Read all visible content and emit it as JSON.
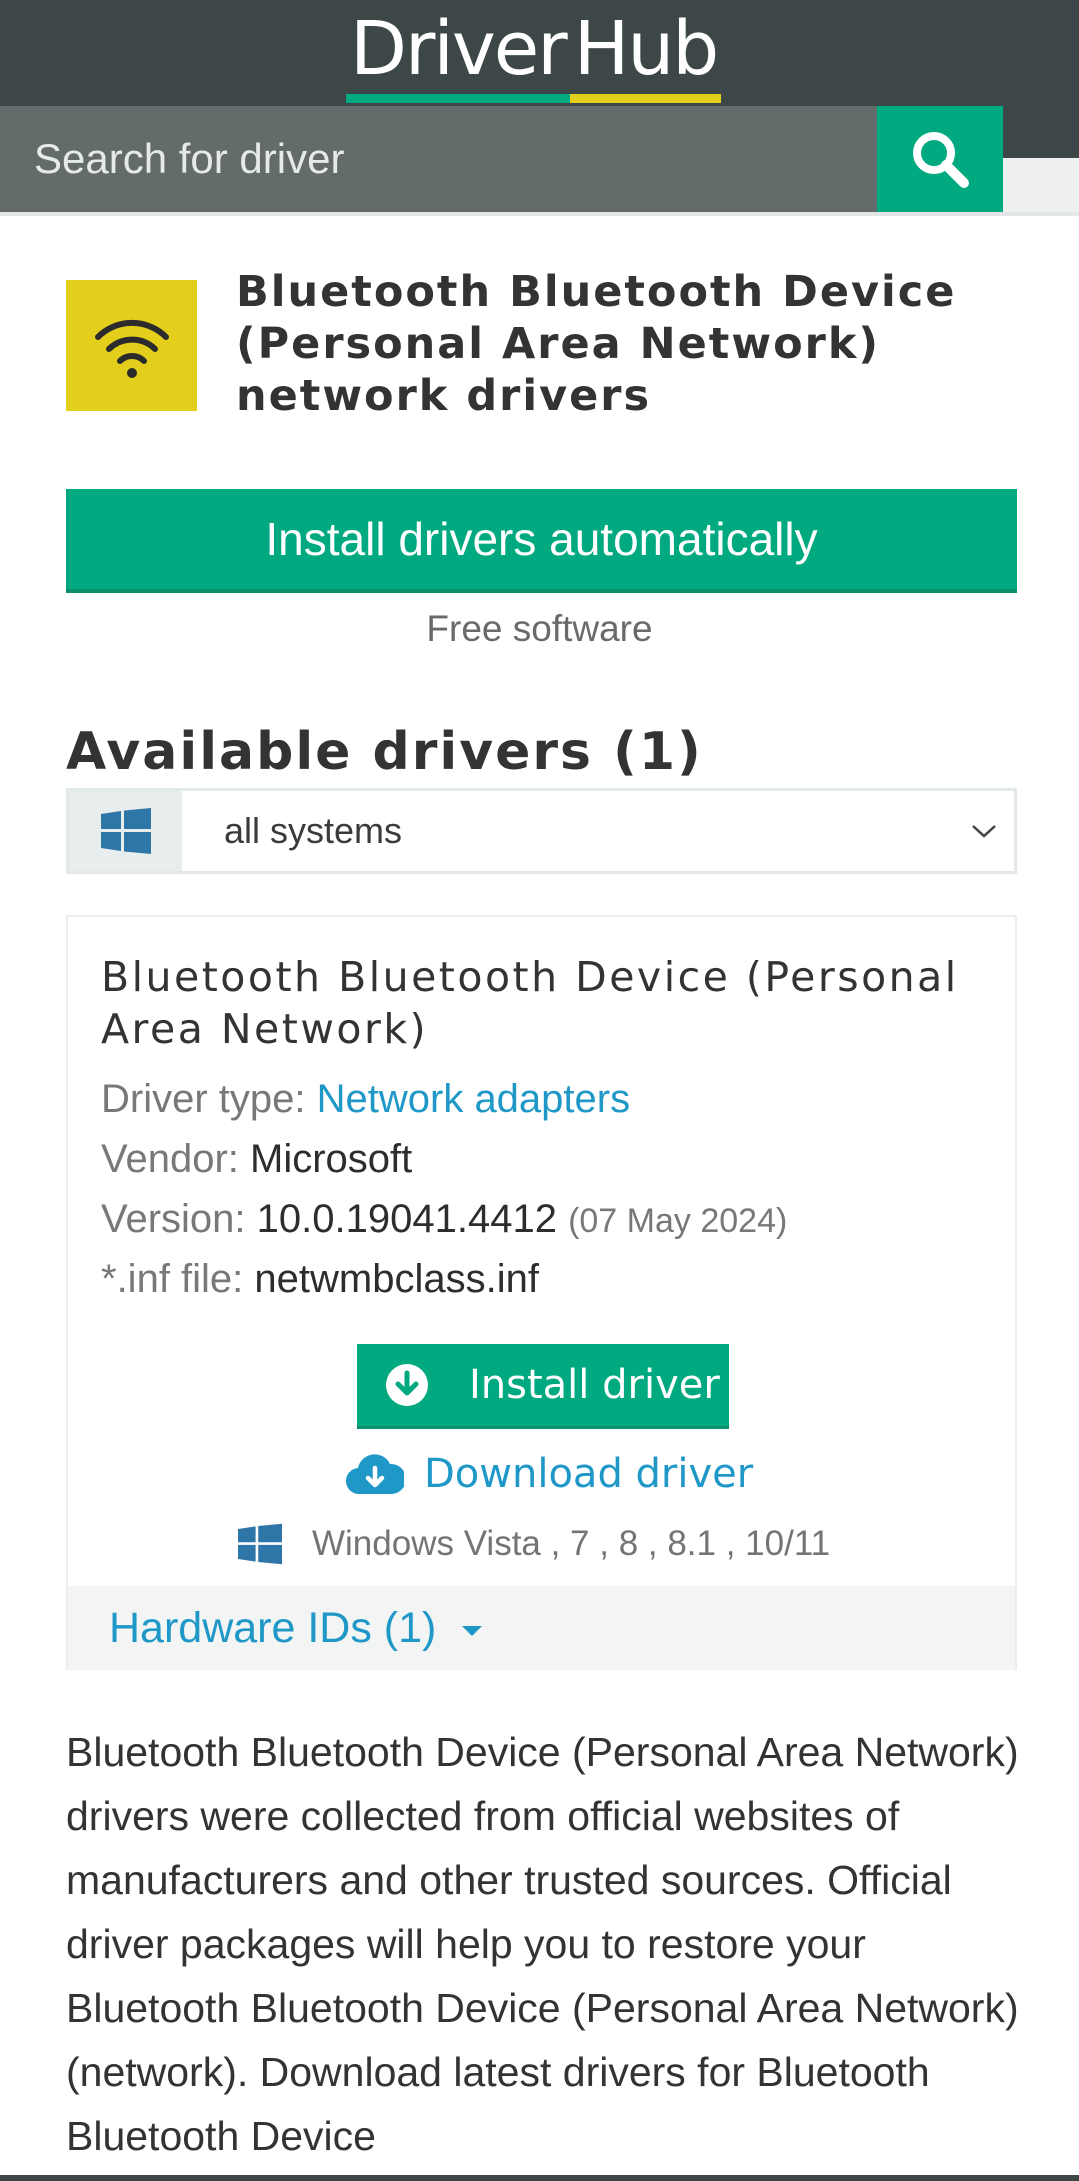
{
  "header": {
    "logo_word1": "Driver",
    "logo_word2": "Hub",
    "search_placeholder": "Search for driver",
    "colors": {
      "bg": "#3d4747",
      "accent_green": "#00a97f",
      "accent_yellow": "#e3cf1b"
    }
  },
  "device": {
    "icon": "wifi-icon",
    "title": "Bluetooth Bluetooth Device (Personal Area Network) network drivers"
  },
  "cta": {
    "install_auto_label": "Install drivers automatically",
    "free_software": "Free software"
  },
  "drivers": {
    "heading": "Available drivers (1)",
    "os_select_value": "all systems",
    "items": [
      {
        "name": "Bluetooth Bluetooth Device (Personal Area Network)",
        "type_label": "Driver type:",
        "type_value": "Network adapters",
        "vendor_label": "Vendor:",
        "vendor_value": "Microsoft",
        "version_label": "Version:",
        "version_value": "10.0.19041.4412",
        "version_date": "(07 May 2024)",
        "inf_label": "*.inf file:",
        "inf_value": "netwmbclass.inf",
        "install_label": "Install driver",
        "download_label": "Download driver",
        "os_support": "Windows Vista , 7 , 8 , 8.1 , 10/11",
        "hardware_ids_label": "Hardware IDs (1)"
      }
    ]
  },
  "description": "Bluetooth Bluetooth Device (Personal Area Network) drivers were collected from official websites of manufacturers and other trusted sources. Official driver packages will help you to restore your Bluetooth Bluetooth Device (Personal Area Network)(network). Download latest drivers for Bluetooth Bluetooth Device"
}
